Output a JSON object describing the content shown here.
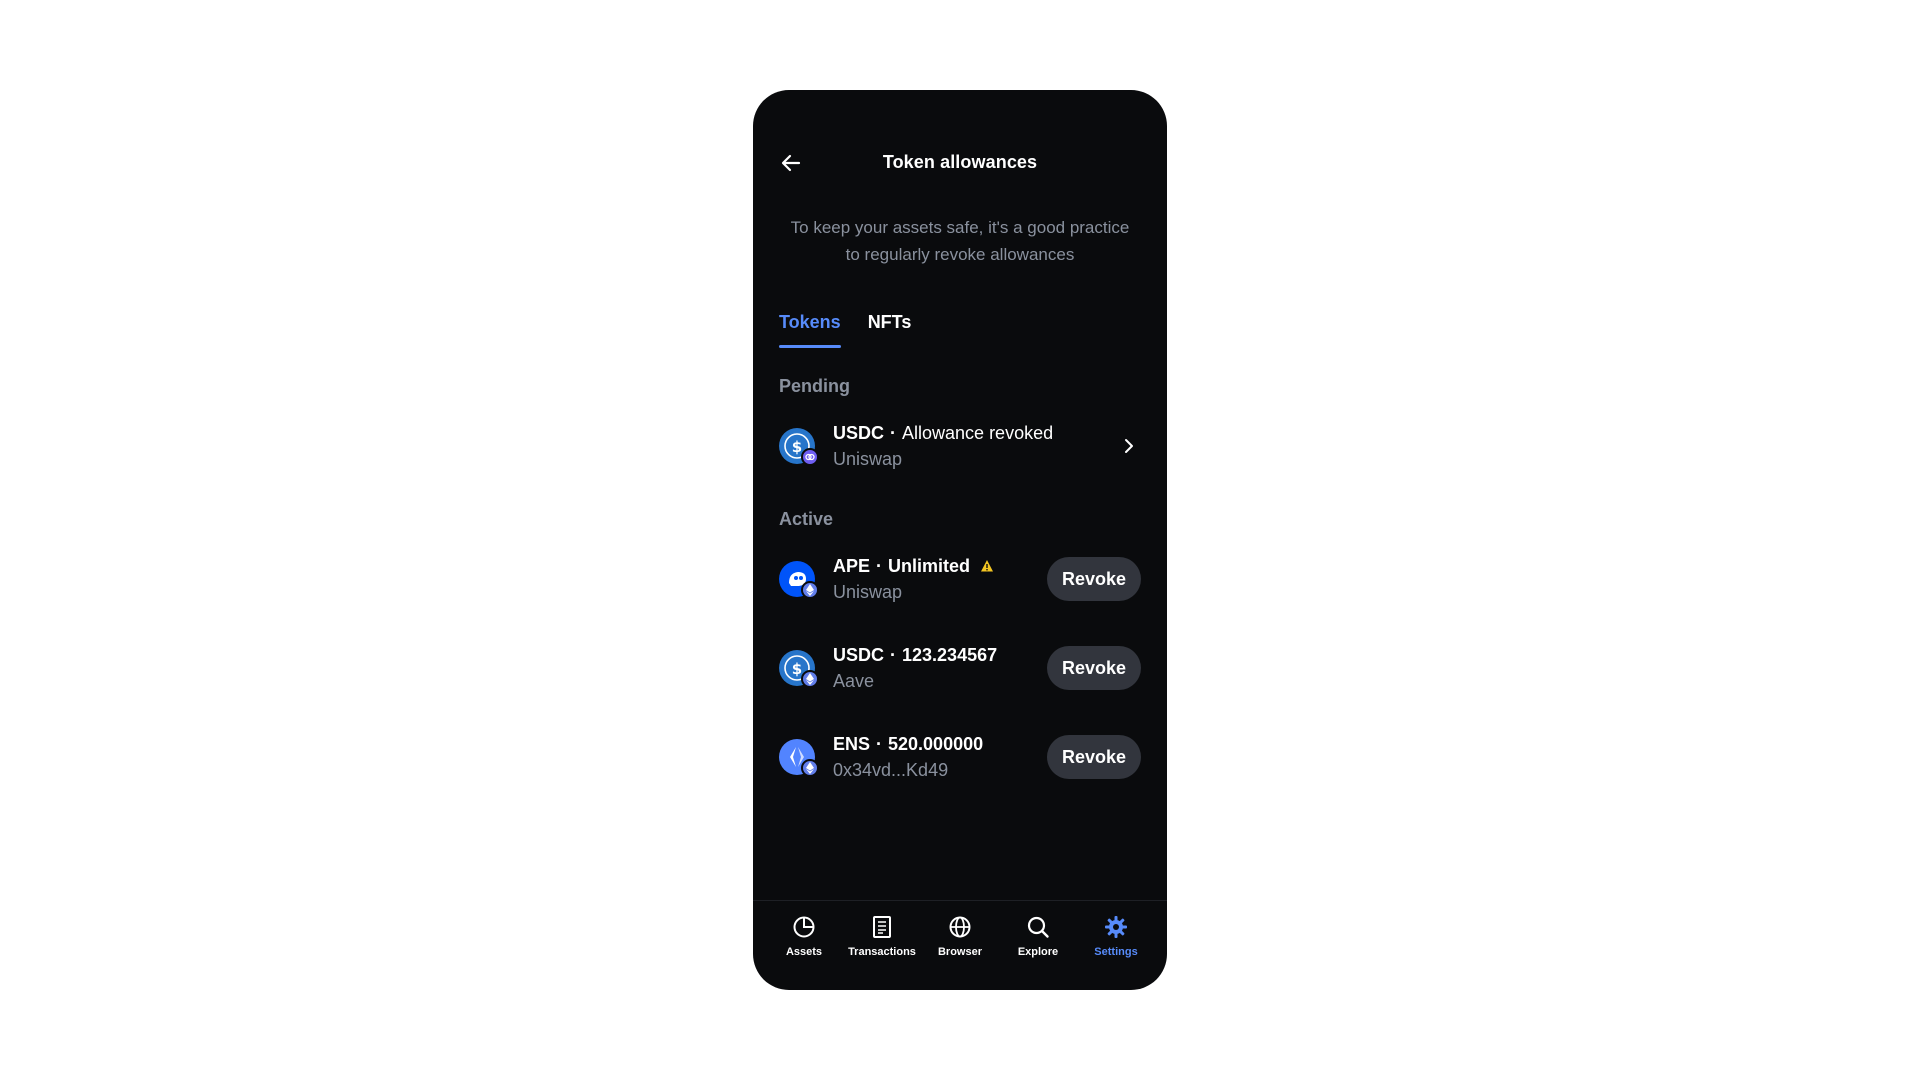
{
  "header": {
    "title": "Token allowances"
  },
  "subtitle": "To keep your assets safe, it's a good practice to regularly revoke allowances",
  "tabs": [
    {
      "label": "Tokens",
      "active": true
    },
    {
      "label": "NFTs",
      "active": false
    }
  ],
  "pending": {
    "label": "Pending",
    "items": [
      {
        "token": "USDC",
        "detail": "Allowance revoked",
        "source": "Uniswap",
        "icon": "usdc-icon",
        "badge": "uniswap-icon"
      }
    ]
  },
  "active": {
    "label": "Active",
    "items": [
      {
        "token": "APE",
        "detail": "Unlimited",
        "source": "Uniswap",
        "icon": "ape-icon",
        "badge": "ethereum-icon",
        "warning": true,
        "action": "Revoke"
      },
      {
        "token": "USDC",
        "detail": "123.234567",
        "source": "Aave",
        "icon": "usdc-icon",
        "badge": "ethereum-icon",
        "action": "Revoke"
      },
      {
        "token": "ENS",
        "detail": "520.000000",
        "source": "0x34vd...Kd49",
        "icon": "ens-icon",
        "badge": "ethereum-icon",
        "action": "Revoke"
      }
    ]
  },
  "nav": [
    {
      "label": "Assets",
      "icon": "pie-chart-icon",
      "active": false
    },
    {
      "label": "Transactions",
      "icon": "document-icon",
      "active": false
    },
    {
      "label": "Browser",
      "icon": "globe-icon",
      "active": false
    },
    {
      "label": "Explore",
      "icon": "search-icon",
      "active": false
    },
    {
      "label": "Settings",
      "icon": "gear-icon",
      "active": true
    }
  ],
  "colors": {
    "background": "#0a0b0d",
    "accent": "#578bfa",
    "muted": "#8a919e",
    "button": "#32353d",
    "warning": "#f4c622"
  }
}
